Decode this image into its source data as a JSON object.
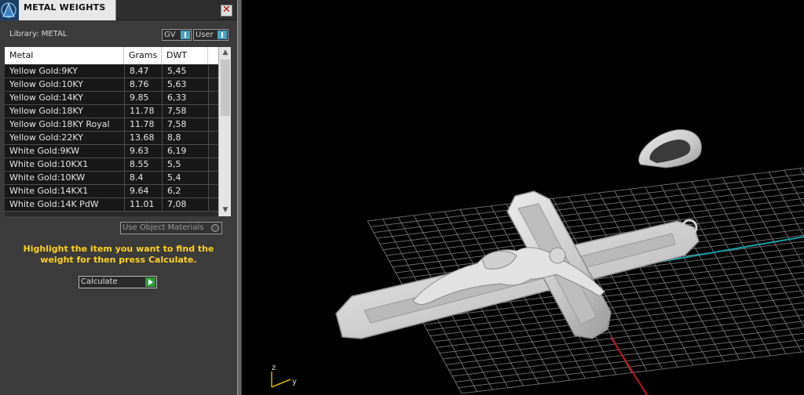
{
  "window": {
    "title": "METAL WEIGHTS",
    "close_glyph": "✕"
  },
  "library": {
    "label": "Library: METAL",
    "gv_label": "GV",
    "user_label": "User"
  },
  "table": {
    "columns": [
      "Metal",
      "Grams",
      "DWT"
    ],
    "rows": [
      [
        "Yellow Gold:9KY",
        "8.47",
        "5,45"
      ],
      [
        "Yellow Gold:10KY",
        "8.76",
        "5,63"
      ],
      [
        "Yellow Gold:14KY",
        "9.85",
        "6,33"
      ],
      [
        "Yellow Gold:18KY",
        "11.78",
        "7,58"
      ],
      [
        "Yellow Gold:18KY Royal",
        "11.78",
        "7,58"
      ],
      [
        "Yellow Gold:22KY",
        "13.68",
        "8,8"
      ],
      [
        "White Gold:9KW",
        "9.63",
        "6,19"
      ],
      [
        "White Gold:10KX1",
        "8.55",
        "5,5"
      ],
      [
        "White Gold:10KW",
        "8.4",
        "5,4"
      ],
      [
        "White Gold:14KX1",
        "9.64",
        "6,2"
      ],
      [
        "White Gold:14K PdW",
        "11.01",
        "7,08"
      ]
    ]
  },
  "use_object_materials": {
    "label": "Use Object Materials"
  },
  "instruction": "Highlight the item you want to find the weight for then press Calculate.",
  "calculate": {
    "label": "Calculate"
  },
  "viewport": {
    "axis_z": "z",
    "axis_y": "y"
  },
  "colors": {
    "accent_yellow": "#ffd21a",
    "grid": "#6a6a6a",
    "y_axis": "#1aa0a8",
    "x_axis": "#c01818",
    "model": "#d4d4d4"
  }
}
